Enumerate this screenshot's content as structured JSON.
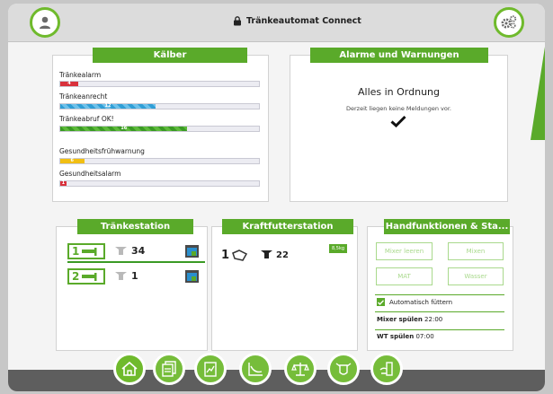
{
  "app": {
    "title": "Tränkeautomat Connect"
  },
  "kaelber": {
    "title": "Kälber",
    "bars": [
      {
        "label": "Tränkealarm",
        "value": "4",
        "fill_fraction": 0.09,
        "color": "#d9313c"
      },
      {
        "label": "Tränkeanrecht",
        "value": "12",
        "fill_fraction": 0.48,
        "color": "#2f9ed6"
      },
      {
        "label": "Tränkeabruf OK!",
        "value": "16",
        "fill_fraction": 0.64,
        "color": "#3a9a24"
      },
      {
        "label": "Gesundheitsfrühwarnung",
        "value": "6",
        "fill_fraction": 0.12,
        "color": "#f1bf13"
      },
      {
        "label": "Gesundheitsalarm",
        "value": "1",
        "fill_fraction": 0.03,
        "color": "#d9313c"
      }
    ]
  },
  "alarme": {
    "title": "Alarme und Warnungen",
    "status": "Alles in Ordnung",
    "message": "Derzeit liegen keine Meldungen vor."
  },
  "traenkestation": {
    "title": "Tränkestation",
    "stations": [
      {
        "number": "1",
        "count": "34"
      },
      {
        "number": "2",
        "count": "1"
      }
    ]
  },
  "kraftfutter": {
    "title": "Kraftfutterstation",
    "number": "1",
    "count": "22",
    "badge": "8,5kg"
  },
  "handfunktionen": {
    "title": "Handfunktionen & Sta...",
    "buttons": [
      "Mixer leeren",
      "Mixen",
      "MAT",
      "Wasser"
    ],
    "auto_feed_label": "Automatisch füttern",
    "auto_feed_checked": true,
    "mixer_spuelen_label": "Mixer spülen",
    "mixer_spuelen_time": "22:00",
    "wt_spuelen_label": "WT spülen",
    "wt_spuelen_time": "07:00"
  },
  "colors": {
    "accent": "#5aaa2a",
    "nav_button": "#6fba2c",
    "bottom_bar": "#5e5e5e"
  },
  "nav": [
    "home-icon",
    "reports-icon",
    "charts-icon",
    "curve-icon",
    "balance-icon",
    "calf-icon",
    "dispenser-icon"
  ]
}
